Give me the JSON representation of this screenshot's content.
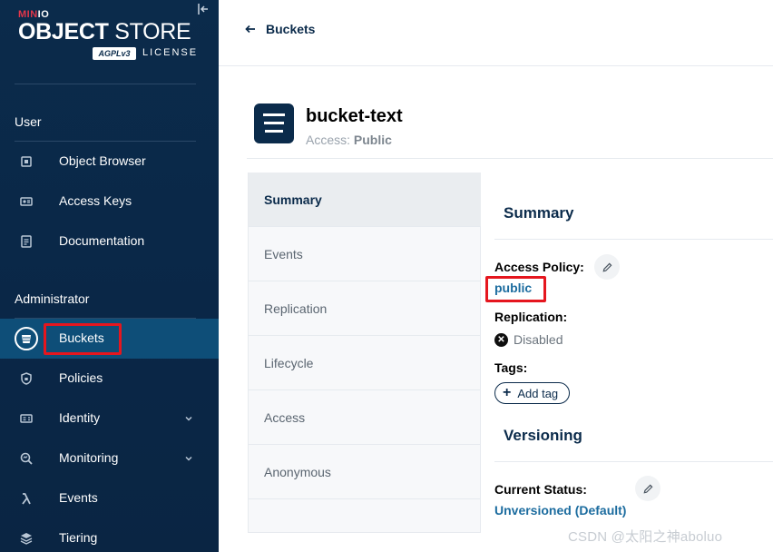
{
  "sidebar": {
    "logo": {
      "brand_a": "MIN",
      "brand_b": "IO",
      "product_bold": "OBJECT",
      "product_light": " STORE",
      "badge": "AGPLv3",
      "license": "LICENSE"
    },
    "user_section": "User",
    "user_items": [
      {
        "label": "Object Browser",
        "icon": "object-browser-icon"
      },
      {
        "label": "Access Keys",
        "icon": "access-keys-icon"
      },
      {
        "label": "Documentation",
        "icon": "documentation-icon"
      }
    ],
    "admin_section": "Administrator",
    "admin_items": [
      {
        "label": "Buckets",
        "icon": "bucket-icon",
        "active": true
      },
      {
        "label": "Policies",
        "icon": "shield-icon"
      },
      {
        "label": "Identity",
        "icon": "identity-icon",
        "expandable": true
      },
      {
        "label": "Monitoring",
        "icon": "monitoring-icon",
        "expandable": true
      },
      {
        "label": "Events",
        "icon": "lambda-icon"
      },
      {
        "label": "Tiering",
        "icon": "tiering-icon"
      }
    ]
  },
  "topbar": {
    "back_label": "Buckets"
  },
  "bucket": {
    "name": "bucket-text",
    "access_prefix": "Access: ",
    "access_value": "Public"
  },
  "tabs": [
    "Summary",
    "Events",
    "Replication",
    "Lifecycle",
    "Access",
    "Anonymous"
  ],
  "summary": {
    "title": "Summary",
    "access_policy_label": "Access Policy:",
    "access_policy_value": "public",
    "replication_label": "Replication:",
    "replication_value": "Disabled",
    "tags_label": "Tags:",
    "add_tag_label": "Add tag"
  },
  "versioning": {
    "title": "Versioning",
    "status_label": "Current Status:",
    "status_value": "Unversioned (Default)"
  },
  "watermark": "CSDN @太阳之神aboluo",
  "colors": {
    "sidebar_bg": "#0b2b4b",
    "active_item": "#0e4e78",
    "link": "#1c6c9f",
    "highlight": "#e5161e"
  }
}
